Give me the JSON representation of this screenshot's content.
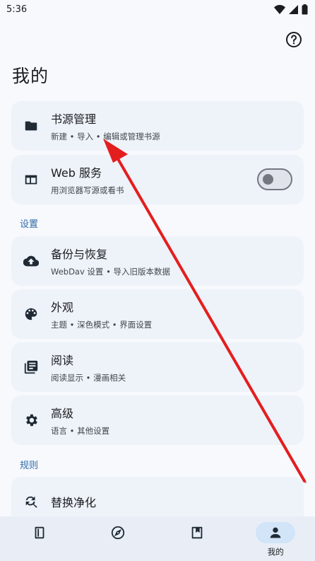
{
  "status_bar": {
    "time": "5:36",
    "icons": [
      "wifi-icon",
      "signal-icon",
      "battery-icon"
    ]
  },
  "page": {
    "title": "我的"
  },
  "main_cards": [
    {
      "title": "书源管理",
      "subtitle": "新建 • 导入 • 编辑或管理书源",
      "icon": "folder-icon"
    },
    {
      "title": "Web 服务",
      "subtitle": "用浏览器写源或看书",
      "icon": "web-window-icon",
      "toggle_on": false
    }
  ],
  "settings_section": {
    "label": "设置",
    "items": [
      {
        "title": "备份与恢复",
        "subtitle": "WebDav 设置 • 导入旧版本数据",
        "icon": "cloud-upload-icon"
      },
      {
        "title": "外观",
        "subtitle": "主题 • 深色模式 • 界面设置",
        "icon": "palette-icon"
      },
      {
        "title": "阅读",
        "subtitle": "阅读显示 • 漫画相关",
        "icon": "library-books-icon"
      },
      {
        "title": "高级",
        "subtitle": "语言 • 其他设置",
        "icon": "gear-icon"
      }
    ]
  },
  "rules_section": {
    "label": "规则",
    "items": [
      {
        "title": "替换净化",
        "icon": "find-replace-icon"
      }
    ]
  },
  "bottom_nav": {
    "items": [
      {
        "icon": "book-icon",
        "label": ""
      },
      {
        "icon": "compass-icon",
        "label": ""
      },
      {
        "icon": "bookmark-box-icon",
        "label": ""
      },
      {
        "icon": "person-icon",
        "label": "我的",
        "active": true
      }
    ]
  },
  "colors": {
    "accent": "#2f6aa8",
    "card_bg": "#eef2f9",
    "page_bg": "#f7f9fd",
    "annotation_arrow": "#e41e1e"
  }
}
